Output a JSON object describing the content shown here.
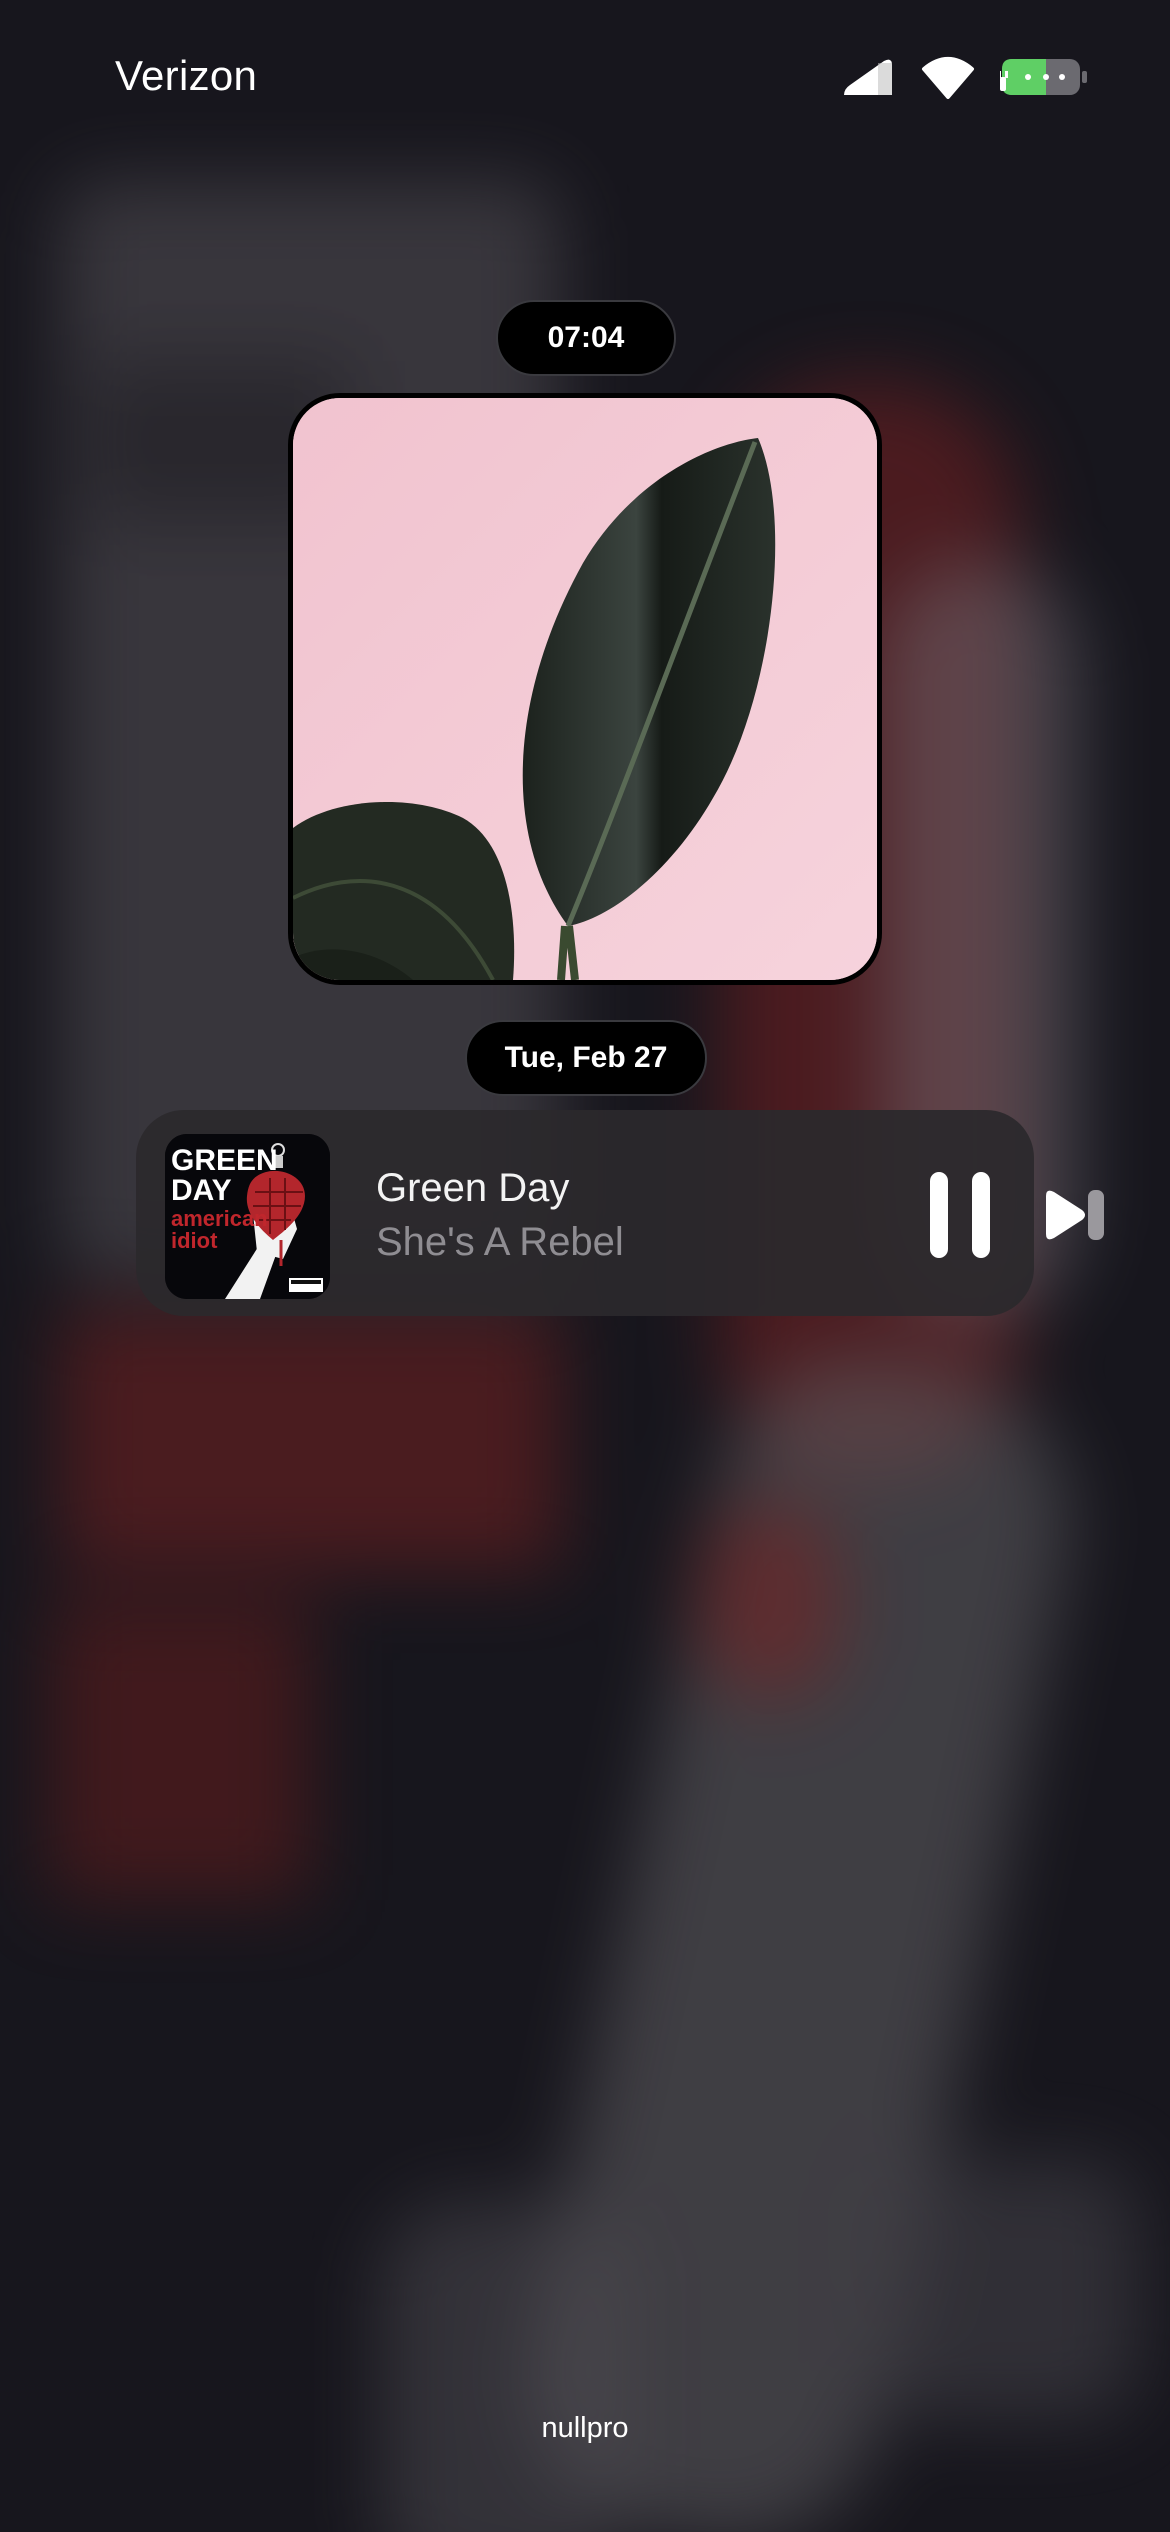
{
  "status_bar": {
    "carrier": "Verizon",
    "icons": [
      "cellular-signal-icon",
      "wifi-icon",
      "battery-charging-icon"
    ],
    "battery_color": "#5fcf65"
  },
  "lock_screen": {
    "time": "07:04",
    "date": "Tue, Feb 27"
  },
  "photo_widget": {
    "subject": "leaf-photo",
    "background_color": "#f2c9d4"
  },
  "now_playing": {
    "artist": "Green Day",
    "song": "She's A Rebel",
    "album_art": {
      "line1": "GREEN",
      "line2": "DAY",
      "line3": "american",
      "line4": "idiot"
    },
    "controls": [
      "pause-icon",
      "next-track-icon"
    ]
  },
  "footer": {
    "text": "nullpro"
  }
}
